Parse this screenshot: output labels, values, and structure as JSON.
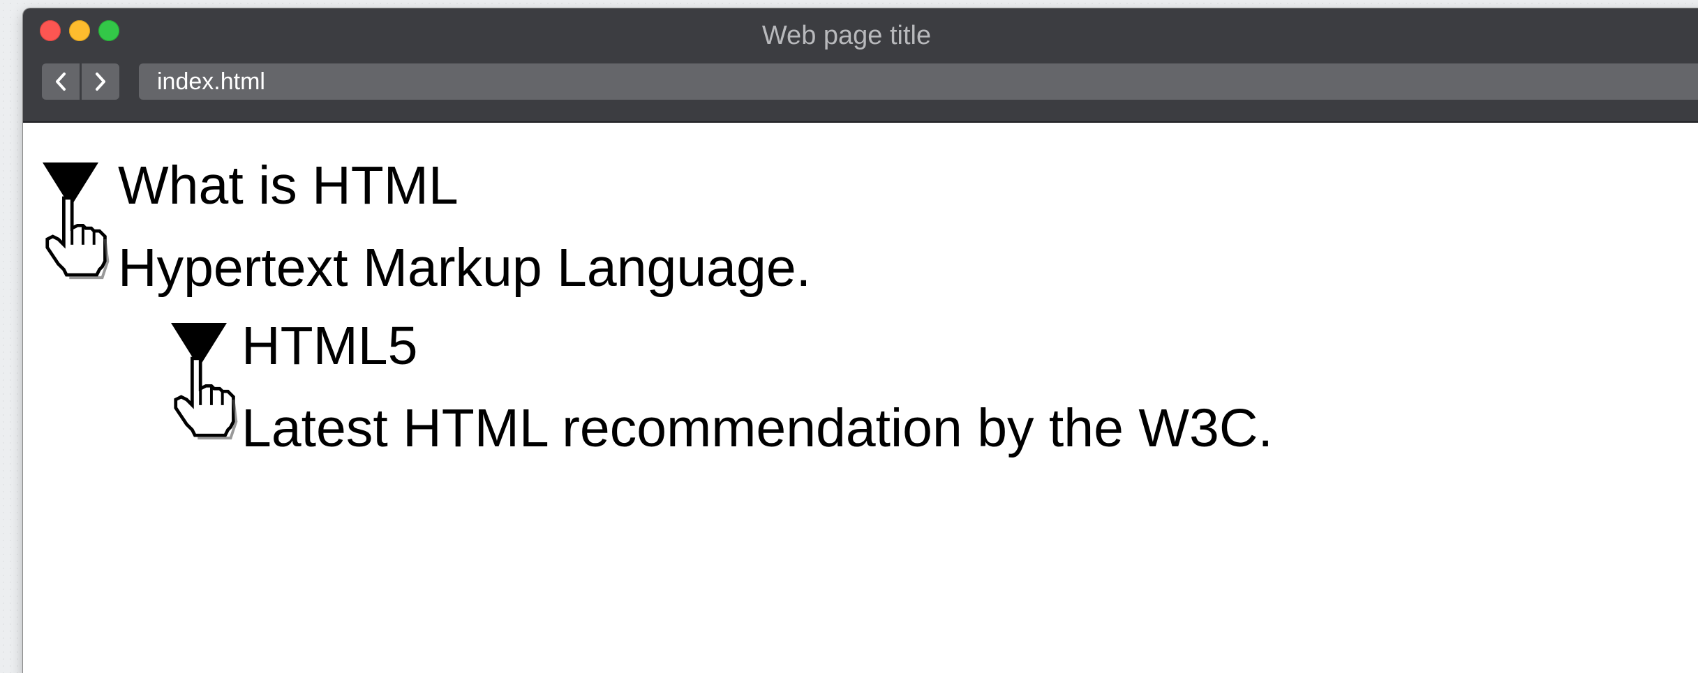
{
  "window": {
    "title": "Web page title",
    "address": "index.html"
  },
  "details": [
    {
      "summary": "What is HTML",
      "body": "Hypertext Markup Language."
    },
    {
      "summary": "HTML5",
      "body": "Latest HTML recommendation by the W3C."
    }
  ]
}
